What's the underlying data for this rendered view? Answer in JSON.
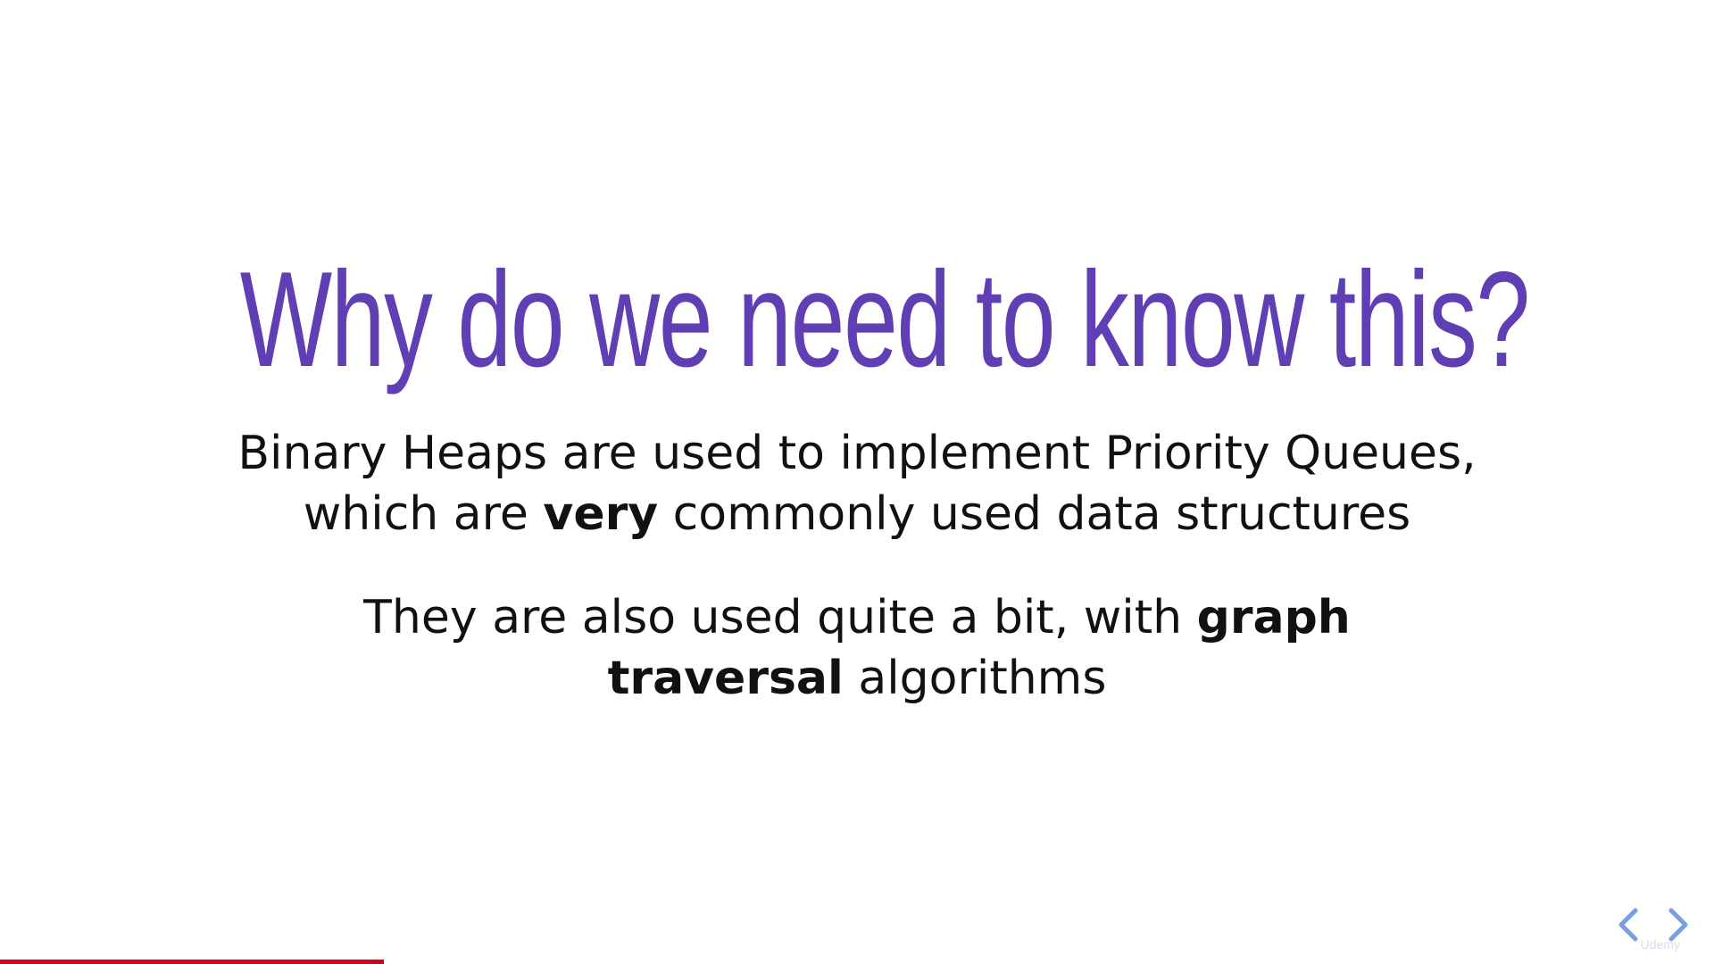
{
  "slide": {
    "title": "Why do we need to know this?",
    "paragraph1": {
      "line1": "Binary Heaps are used to implement Priority Queues,",
      "line2_before": "which are ",
      "line2_bold": "very",
      "line2_after": " commonly used data structures"
    },
    "paragraph2": {
      "line1_before": "They are also used quite a bit, with ",
      "line1_bold": "graph",
      "line2_bold": "traversal",
      "line2_after": " algorithms"
    }
  },
  "player": {
    "progress": 0.224,
    "watermark": "Udemy"
  },
  "icons": {
    "prev": "chevron-left-icon",
    "next": "chevron-right-icon"
  },
  "colors": {
    "title": "#5f3fb3",
    "text": "#111111",
    "progress": "#d0021b",
    "nav_arrows": "#7a9fe0"
  }
}
